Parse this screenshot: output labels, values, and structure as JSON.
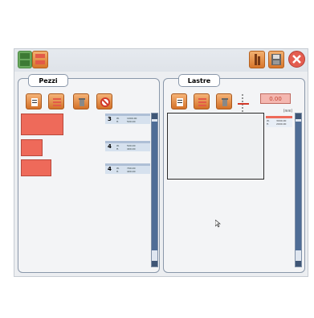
{
  "panels": {
    "pieces": {
      "title": "Pezzi"
    },
    "slabs": {
      "title": "Lastre"
    }
  },
  "pieces_list": [
    {
      "qty": "3",
      "w_label": "W.",
      "h_label": "H.",
      "w": "1000.00",
      "h": "500.00"
    },
    {
      "qty": "4",
      "w_label": "W.",
      "h_label": "H.",
      "w": "500.00",
      "h": "400.00"
    },
    {
      "qty": "4",
      "w_label": "W.",
      "h_label": "H.",
      "w": "700.00",
      "h": "400.00"
    }
  ],
  "slabs_panel": {
    "value_display": "0.00",
    "unit": "[mm]",
    "item": {
      "w_label": "W.",
      "h_label": "H.",
      "w": "3000.00",
      "h": "2000.00"
    }
  },
  "colors": {
    "accent_orange": "#e08a3c",
    "piece_red": "#ee6a5a",
    "scroll_blue": "#4f6d96"
  },
  "icons": {
    "top_left": "layout-icon",
    "top_right_1": "cut-icon",
    "top_right_2": "save-icon",
    "top_right_3": "close-icon",
    "pieces_tools": [
      "calculator-icon",
      "list-icon",
      "delete-icon",
      "forbidden-icon"
    ],
    "slabs_tools": [
      "calculator-icon",
      "list-icon",
      "delete-icon"
    ]
  }
}
